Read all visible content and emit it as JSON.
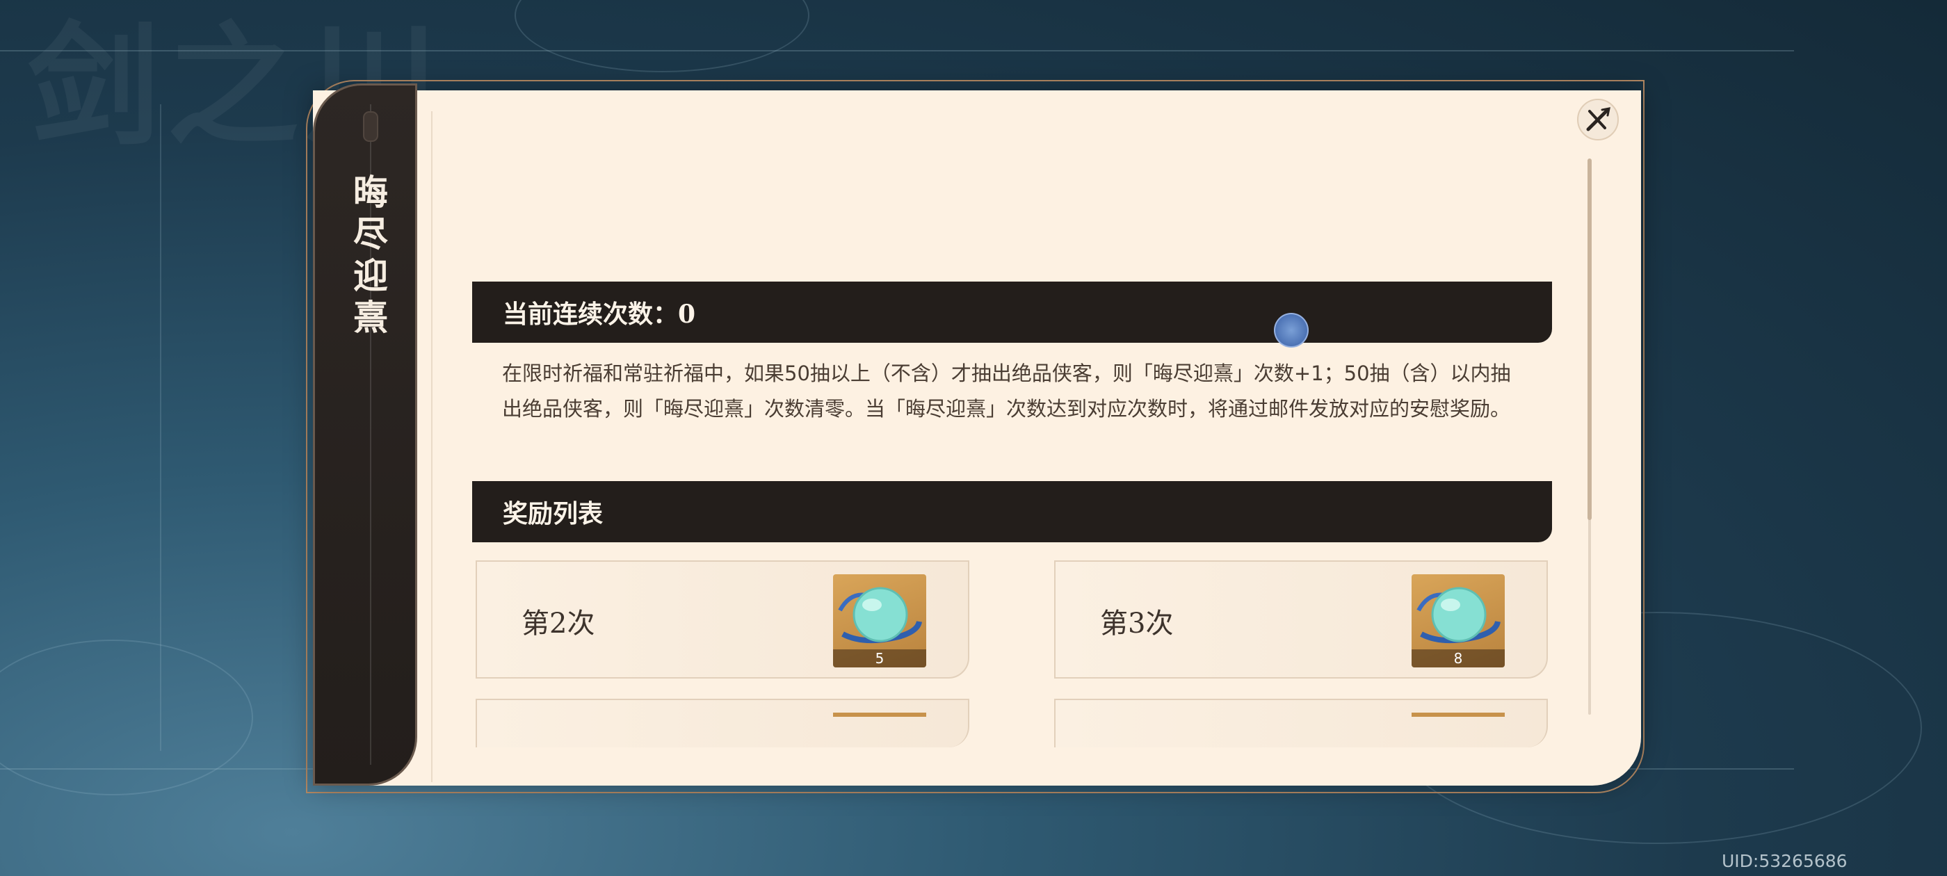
{
  "background": {
    "watermark": "剑之川"
  },
  "side_tab": {
    "title": "晦尽迎熹"
  },
  "streak_section": {
    "header": "当前连续次数：0",
    "description": "在限时祈福和常驻祈福中，如果50抽以上（不含）才抽出绝品侠客，则「晦尽迎熹」次数+1；50抽（含）以内抽出绝品侠客，则「晦尽迎熹」次数清零。当「晦尽迎熹」次数达到对应次数时，将通过邮件发放对应的安慰奖励。"
  },
  "rewards_section": {
    "header": "奖励列表",
    "items": [
      {
        "label": "第2次",
        "icon": "jade-orb-icon",
        "count": "5"
      },
      {
        "label": "第3次",
        "icon": "jade-orb-icon",
        "count": "8"
      }
    ]
  },
  "footer": {
    "uid": "UID:53265686"
  },
  "colors": {
    "panel_bg": "#fdf1e2",
    "header_bg": "#231e1b",
    "item_bg": "#c9924a",
    "frame_border": "#b58a64"
  }
}
